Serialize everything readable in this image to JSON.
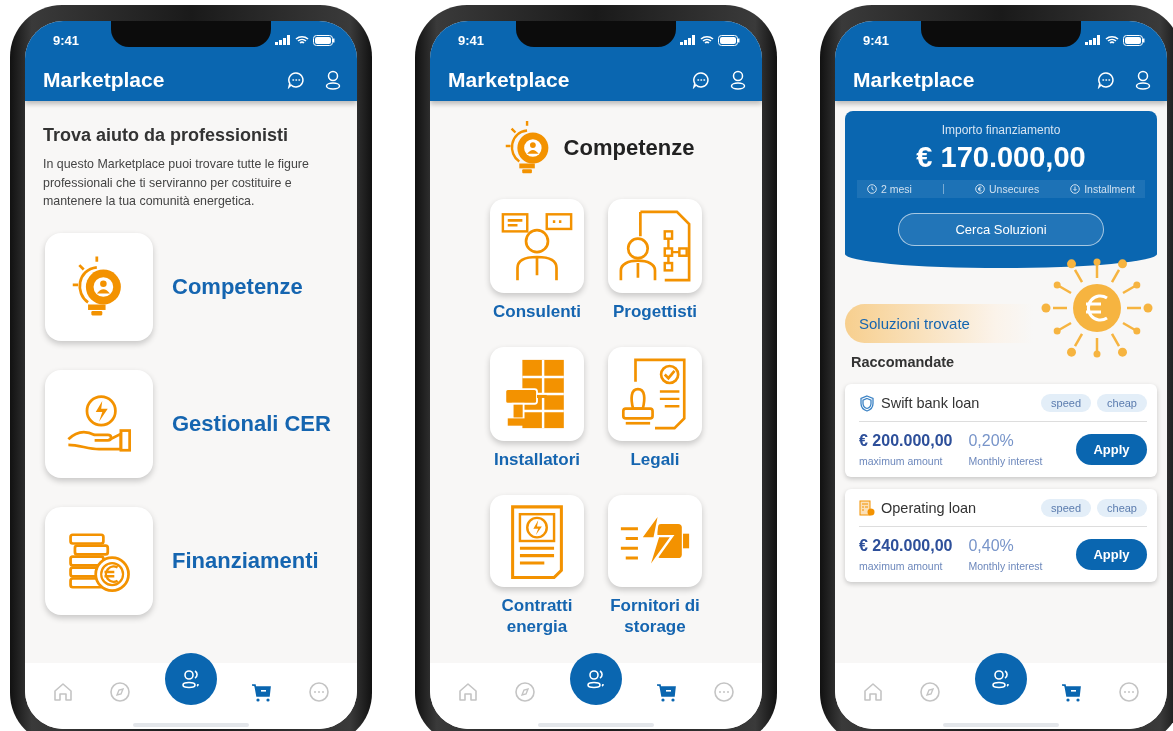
{
  "phones": [
    {
      "time": "9:41",
      "title": "Marketplace",
      "screen": {
        "kind": "home",
        "heading": "Trova aiuto da professionisti",
        "intro": "In questo Marketplace puoi trovare tutte le figure professionali che ti serviranno per costituire e mantenere la tua comunità energetica.",
        "categories": [
          "Competenze",
          "Gestionali CER",
          "Finanziamenti"
        ]
      },
      "nav": [
        {
          "kind": "home",
          "selected": false
        },
        {
          "kind": "explore",
          "selected": false
        },
        {
          "kind": "cart",
          "selected": true
        },
        {
          "kind": "more",
          "selected": false
        }
      ]
    },
    {
      "time": "9:41",
      "title": "Marketplace",
      "screen": {
        "kind": "grid",
        "heading": "Competenze",
        "items": [
          "Consulenti",
          "Progettisti",
          "Installatori",
          "Legali",
          "Contratti energia",
          "Fornitori di storage"
        ]
      },
      "nav": [
        {
          "kind": "home",
          "selected": false
        },
        {
          "kind": "explore",
          "selected": false
        },
        {
          "kind": "cart",
          "selected": true
        },
        {
          "kind": "more",
          "selected": false
        }
      ]
    },
    {
      "time": "9:41",
      "title": "Marketplace",
      "screen": {
        "kind": "results",
        "finance": {
          "label": "Importo finanziamento",
          "amount": "€ 170.000,00",
          "details": [
            {
              "kind": "clock",
              "text": "2 mesi"
            },
            {
              "kind": "euro",
              "text": "Unsecures"
            },
            {
              "kind": "download",
              "text": "Installment"
            }
          ],
          "button": "Cerca Soluzioni"
        },
        "found": "Soluzioni trovate",
        "section": "Raccomandate",
        "loans": [
          {
            "kind": "shield",
            "name": "Swift bank loan",
            "tags": [
              "speed",
              "cheap"
            ],
            "amount": "€ 200.000,00",
            "amount_label": "maximum amount",
            "rate": "0,20%",
            "rate_label": "Monthly interest",
            "button": "Apply"
          },
          {
            "kind": "calculator",
            "name": "Operating loan",
            "tags": [
              "speed",
              "cheap"
            ],
            "amount": "€ 240.000,00",
            "amount_label": "maximum amount",
            "rate": "0,40%",
            "rate_label": "Monthly interest",
            "button": "Apply"
          }
        ]
      },
      "nav": [
        {
          "kind": "home",
          "selected": false
        },
        {
          "kind": "explore",
          "selected": false
        },
        {
          "kind": "cart",
          "selected": true
        },
        {
          "kind": "more",
          "selected": false
        }
      ]
    }
  ]
}
